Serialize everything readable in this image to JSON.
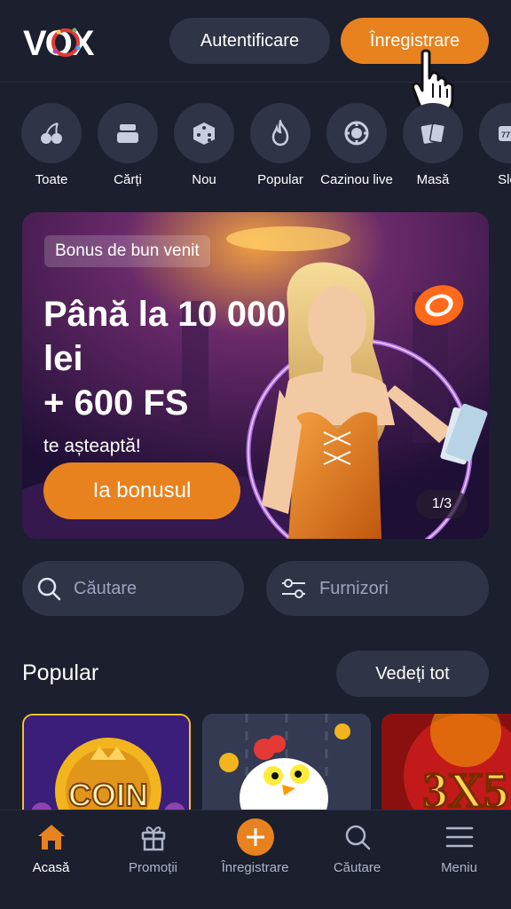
{
  "header": {
    "logo_text": "VOX",
    "login_label": "Autentificare",
    "register_label": "Înregistrare"
  },
  "categories": [
    {
      "label": "Toate",
      "icon": "cherries-icon"
    },
    {
      "label": "Cărți",
      "icon": "stack-icon"
    },
    {
      "label": "Nou",
      "icon": "dice-icon"
    },
    {
      "label": "Popular",
      "icon": "fire-icon"
    },
    {
      "label": "Cazinou live",
      "icon": "chip-icon"
    },
    {
      "label": "Masă",
      "icon": "cards-icon"
    },
    {
      "label": "Slot",
      "icon": "slot-icon"
    }
  ],
  "banner": {
    "badge": "Bonus de bun venit",
    "headline_line1": "Până la 10 000",
    "headline_line2": "lei",
    "headline_line3": "+ 600 FS",
    "subtext": "te așteaptă!",
    "cta": "Ia bonusul",
    "pager": "1/3"
  },
  "search": {
    "placeholder": "Căutare"
  },
  "providers": {
    "label": "Furnizori"
  },
  "popular": {
    "title": "Popular",
    "see_all": "Vedeți tot"
  },
  "games": [
    {
      "title": "COIN"
    },
    {
      "title": ""
    },
    {
      "title": "3X5"
    }
  ],
  "bottom_nav": [
    {
      "label": "Acasă",
      "icon": "home-icon"
    },
    {
      "label": "Promoții",
      "icon": "gift-icon"
    },
    {
      "label": "Înregistrare",
      "icon": "plus-icon"
    },
    {
      "label": "Căutare",
      "icon": "search-icon"
    },
    {
      "label": "Meniu",
      "icon": "menu-icon"
    }
  ],
  "colors": {
    "accent": "#e8821e",
    "background": "#1b1f2e",
    "surface": "#2f3446"
  }
}
